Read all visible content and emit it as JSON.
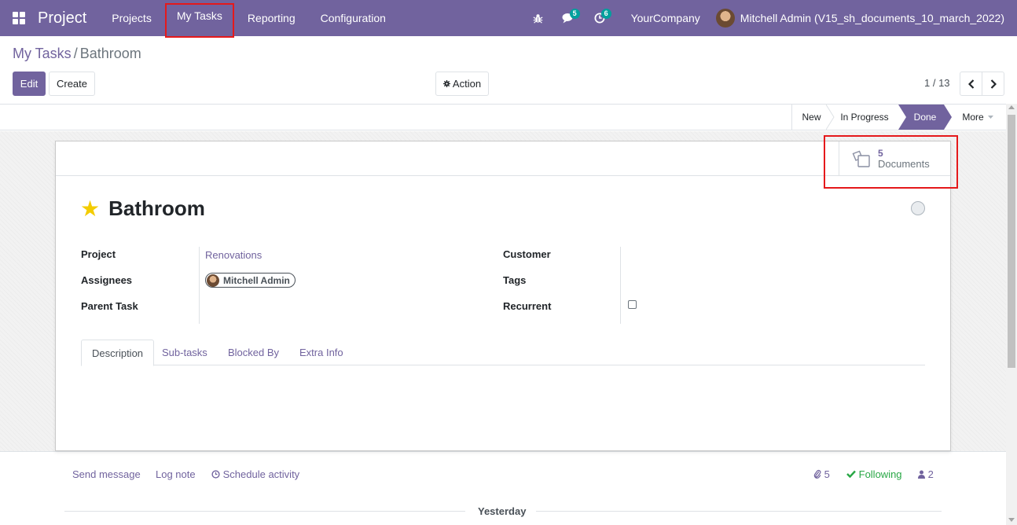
{
  "navbar": {
    "app_name": "Project",
    "menu": [
      "Projects",
      "My Tasks",
      "Reporting",
      "Configuration"
    ],
    "messages_count": "5",
    "activities_count": "6",
    "company": "YourCompany",
    "user": "Mitchell Admin (V15_sh_documents_10_march_2022)"
  },
  "breadcrumb": {
    "parent": "My Tasks",
    "separator": "/",
    "current": "Bathroom"
  },
  "toolbar": {
    "edit_label": "Edit",
    "create_label": "Create",
    "action_label": "Action",
    "pager": "1 / 13"
  },
  "statusbar": {
    "stages": [
      "New",
      "In Progress",
      "Done"
    ],
    "more_label": "More",
    "active_stage": "Done"
  },
  "smart_button": {
    "value": "5",
    "label": "Documents"
  },
  "task": {
    "title": "Bathroom",
    "fields": {
      "project_label": "Project",
      "project_value": "Renovations",
      "assignees_label": "Assignees",
      "assignee": "Mitchell Admin",
      "parent_task_label": "Parent Task",
      "customer_label": "Customer",
      "tags_label": "Tags",
      "recurrent_label": "Recurrent"
    },
    "tabs": [
      "Description",
      "Sub-tasks",
      "Blocked By",
      "Extra Info"
    ],
    "active_tab": "Description"
  },
  "chatter": {
    "send_message": "Send message",
    "log_note": "Log note",
    "schedule_activity": "Schedule activity",
    "attachments_count": "5",
    "following_label": "Following",
    "followers_count": "2",
    "date_separator": "Yesterday"
  },
  "colors": {
    "brand": "#71639e",
    "highlight": "#e5191b",
    "badge": "#00a09d",
    "star": "#f3cc00",
    "following": "#28a745"
  }
}
